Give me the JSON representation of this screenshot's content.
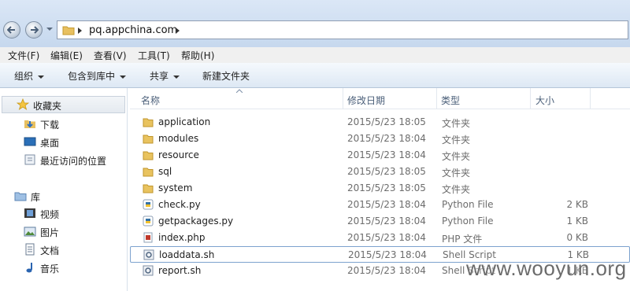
{
  "address": {
    "path": "pq.appchina.com"
  },
  "menu": [
    "文件(F)",
    "编辑(E)",
    "查看(V)",
    "工具(T)",
    "帮助(H)"
  ],
  "toolbar": {
    "organize": "组织",
    "include_library": "包含到库中",
    "share": "共享",
    "new_folder": "新建文件夹"
  },
  "sidebar": {
    "favorites": {
      "label": "收藏夹",
      "items": [
        "下载",
        "桌面",
        "最近访问的位置"
      ]
    },
    "libraries": {
      "label": "库",
      "items": [
        "视频",
        "图片",
        "文档",
        "音乐"
      ]
    }
  },
  "columns": {
    "name": "名称",
    "modified": "修改日期",
    "type": "类型",
    "size": "大小"
  },
  "files": [
    {
      "name": "application",
      "modified": "2015/5/23 18:05",
      "type": "文件夹",
      "size": "",
      "icon": "folder-icon"
    },
    {
      "name": "modules",
      "modified": "2015/5/23 18:04",
      "type": "文件夹",
      "size": "",
      "icon": "folder-icon"
    },
    {
      "name": "resource",
      "modified": "2015/5/23 18:04",
      "type": "文件夹",
      "size": "",
      "icon": "folder-icon"
    },
    {
      "name": "sql",
      "modified": "2015/5/23 18:05",
      "type": "文件夹",
      "size": "",
      "icon": "folder-icon"
    },
    {
      "name": "system",
      "modified": "2015/5/23 18:05",
      "type": "文件夹",
      "size": "",
      "icon": "folder-icon"
    },
    {
      "name": "check.py",
      "modified": "2015/5/23 18:04",
      "type": "Python File",
      "size": "2 KB",
      "icon": "python-file-icon"
    },
    {
      "name": "getpackages.py",
      "modified": "2015/5/23 18:04",
      "type": "Python File",
      "size": "1 KB",
      "icon": "python-file-icon"
    },
    {
      "name": "index.php",
      "modified": "2015/5/23 18:04",
      "type": "PHP 文件",
      "size": "0 KB",
      "icon": "php-file-icon"
    },
    {
      "name": "loaddata.sh",
      "modified": "2015/5/23 18:04",
      "type": "Shell Script",
      "size": "1 KB",
      "icon": "shell-script-icon",
      "selected": true
    },
    {
      "name": "report.sh",
      "modified": "2015/5/23 18:04",
      "type": "Shell Script",
      "size": "1 KB",
      "icon": "shell-script-icon"
    }
  ],
  "watermark": "www.wooyun.org"
}
